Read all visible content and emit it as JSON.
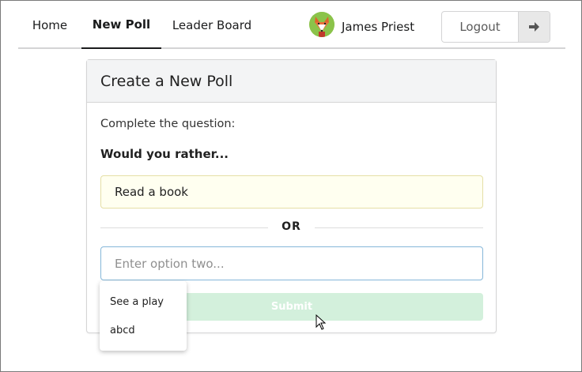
{
  "nav": {
    "items": [
      {
        "label": "Home",
        "active": false
      },
      {
        "label": "New Poll",
        "active": true
      },
      {
        "label": "Leader Board",
        "active": false
      }
    ],
    "user": {
      "name": "James Priest",
      "avatar_icon": "fox-avatar-icon"
    },
    "logout": {
      "label": "Logout",
      "icon": "sign-out-icon"
    }
  },
  "card": {
    "title": "Create a New Poll",
    "prompt": "Complete the question:",
    "question": "Would you rather...",
    "option_one": "Read a book",
    "or_label": "OR",
    "option_two": {
      "value": "",
      "placeholder": "Enter option two..."
    },
    "submit_label": "Submit"
  },
  "suggestions": [
    "See a play",
    "abcd"
  ],
  "colors": {
    "header_bg": "#f3f4f5",
    "option_one_bg": "#fffff0",
    "input_focus_border": "#85b7d9",
    "submit_disabled": "#d3f0dc"
  }
}
